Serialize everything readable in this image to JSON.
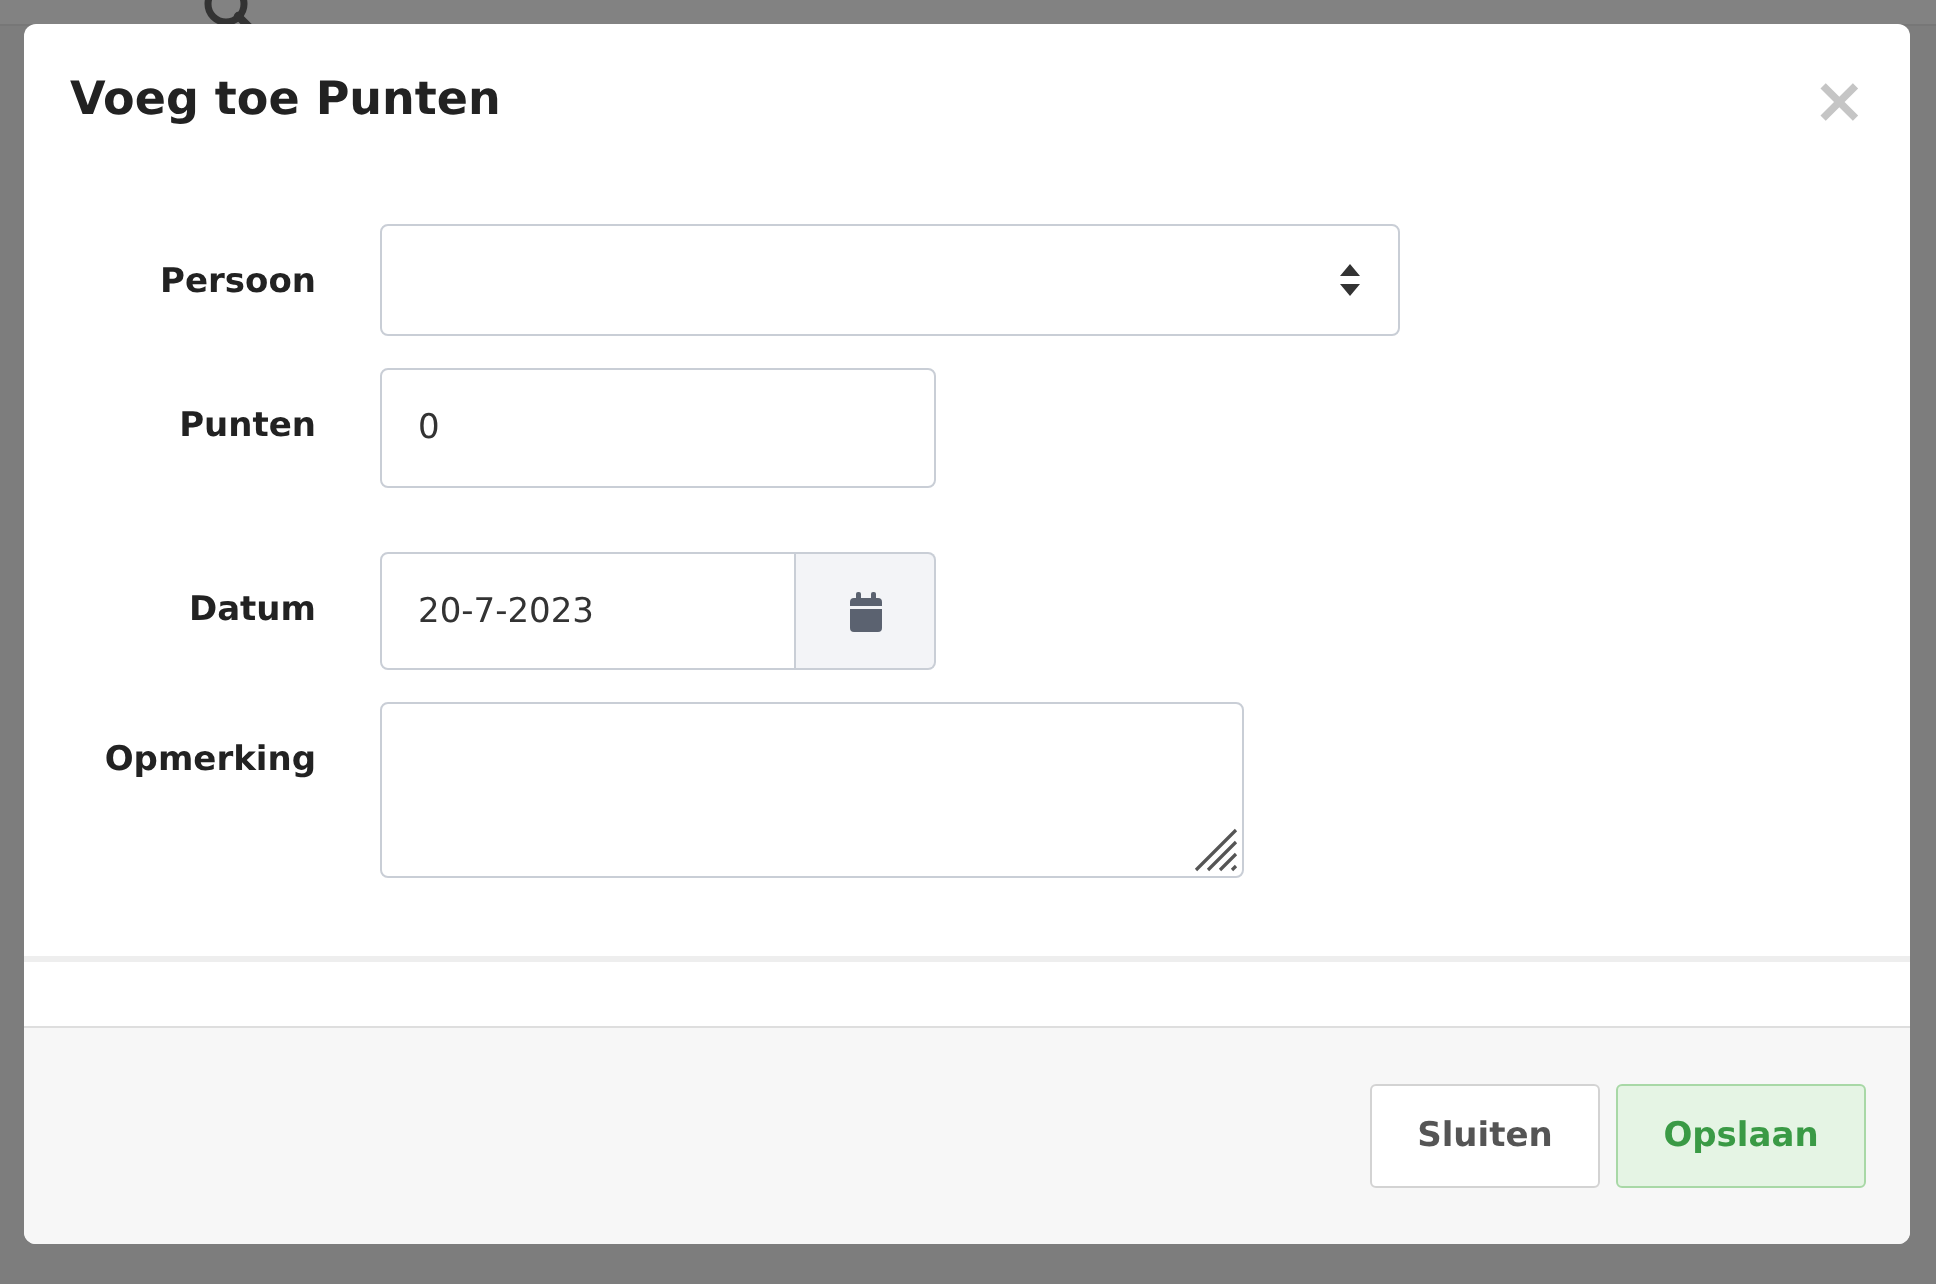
{
  "window": {
    "title": "Voeg toe Punten",
    "close": "×"
  },
  "fields": [
    {
      "kind": "select",
      "label": "Persoon"
    },
    {
      "kind": "text",
      "label": "Punten",
      "value": "0"
    },
    {
      "kind": "date",
      "label": "Datum",
      "value": "20-7-2023"
    },
    {
      "kind": "textarea",
      "label": "Opmerking"
    }
  ],
  "buttons": [
    {
      "kind": "default",
      "label": "Sluiten"
    },
    {
      "kind": "primary",
      "label": "Opslaan"
    }
  ]
}
